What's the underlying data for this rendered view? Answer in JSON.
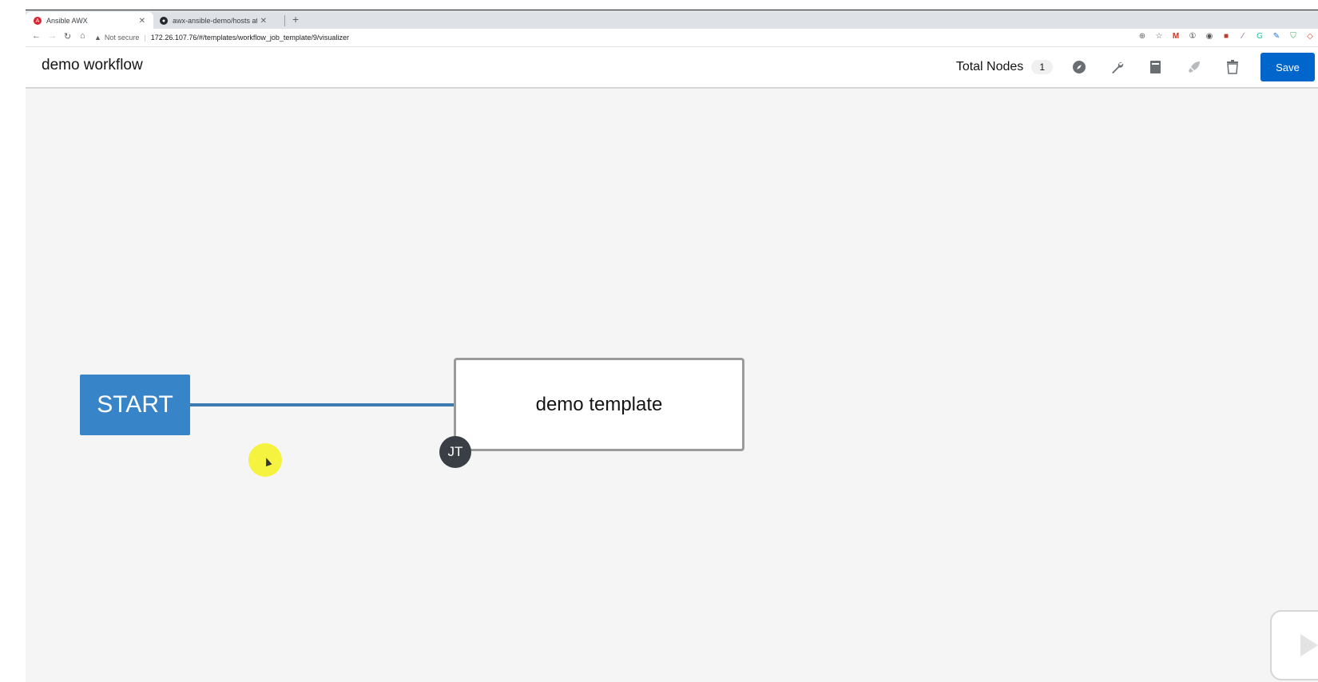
{
  "browser": {
    "tabs": [
      {
        "title": "Ansible AWX",
        "favicon": "awx-favicon-icon",
        "active": true
      },
      {
        "title": "awx-ansible-demo/hosts at mas",
        "favicon": "github-icon",
        "active": false
      }
    ],
    "security_label": "Not secure",
    "url": "172.26.107.76/#/templates/workflow_job_template/9/visualizer",
    "extensions": [
      "zoom-icon",
      "star-icon",
      "gmail-icon",
      "password-icon",
      "extension-icon",
      "extension-icon",
      "extension-icon",
      "grammarly-icon",
      "pen-icon",
      "shield-icon",
      "extension-icon"
    ]
  },
  "header": {
    "title": "demo workflow",
    "total_nodes_label": "Total Nodes",
    "total_nodes_count": "1",
    "icons": [
      "compass-icon",
      "wrench-icon",
      "book-icon",
      "rocket-icon",
      "trash-icon"
    ],
    "save_label": "Save"
  },
  "workflow": {
    "start_label": "START",
    "nodes": [
      {
        "name": "demo template",
        "type_badge": "JT"
      }
    ]
  },
  "colors": {
    "start_node": "#3785c8",
    "link": "#3c7ab0",
    "save_button": "#0066cc",
    "jt_badge": "#393f44",
    "canvas_bg": "#f5f5f5"
  }
}
